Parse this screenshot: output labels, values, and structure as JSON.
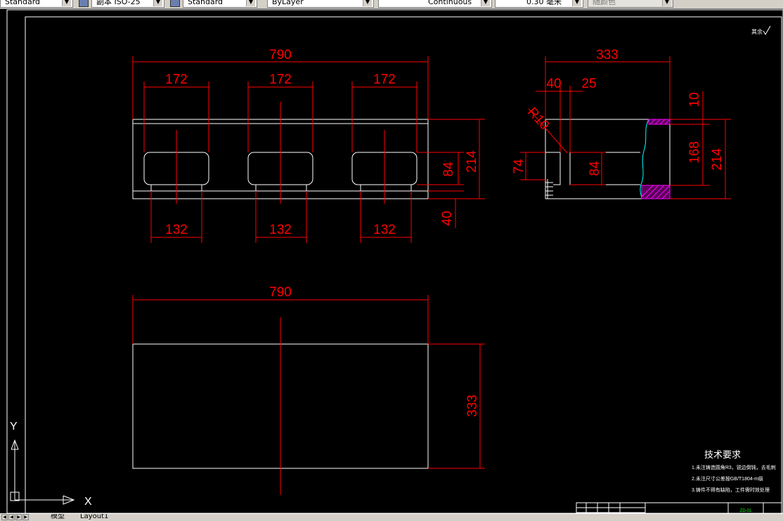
{
  "toolbar": {
    "text_style": "Standard",
    "dim_style": "副本 ISO-25",
    "table_style": "Standard",
    "layer": "ByLayer",
    "linetype": "Continuous",
    "lineweight": "0.30 毫米",
    "plot_style": "随颜色"
  },
  "drawing": {
    "front_view": {
      "overall_width": "790",
      "slot_widths": [
        "172",
        "172",
        "172"
      ],
      "bottom_widths": [
        "132",
        "132",
        "132"
      ],
      "height": "214",
      "slot_height": "84",
      "base_height": "40"
    },
    "side_view": {
      "overall_width": "333",
      "dim_40": "40",
      "dim_25": "25",
      "radius": "R10",
      "dim_10": "10",
      "dim_168": "168",
      "height": "214",
      "dim_74": "74",
      "dim_84": "84"
    },
    "top_view": {
      "overall_width": "790",
      "depth": "333"
    },
    "roughness_note": "其余",
    "tech_requirements": {
      "title": "技术要求",
      "items": [
        "1.未注铸造圆角R3，锐边倒钝，去毛刺",
        "2.未注尺寸公差按GB/T1804-m级",
        "3.铸件不得有缺陷，工件需时效处理"
      ]
    },
    "title_block": {
      "drawing_no": "ZD-01"
    },
    "ucs": {
      "x_label": "X",
      "y_label": "Y"
    }
  },
  "statusbar": {
    "model_tab": "模型",
    "layout_tab": "Layout1"
  },
  "colors": {
    "background": "#000000",
    "geometry": "#ffffff",
    "dimension": "#ff0000",
    "hatch": "#ff00ff",
    "break_line": "#00ffff",
    "toolbar": "#d4d0c8"
  }
}
